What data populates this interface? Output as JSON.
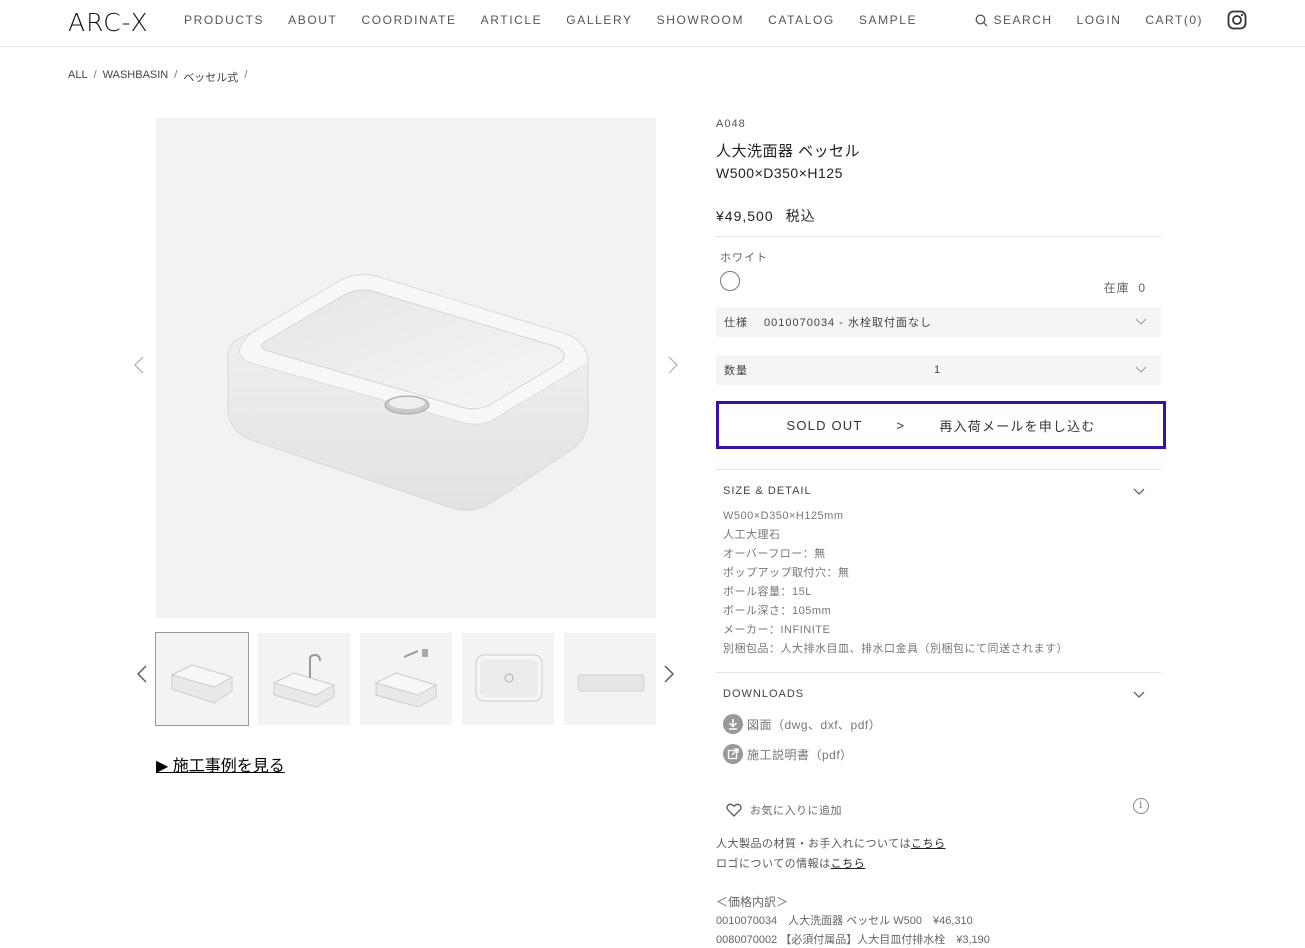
{
  "header": {
    "logo": "ARC-X",
    "nav": [
      "PRODUCTS",
      "ABOUT",
      "COORDINATE",
      "ARTICLE",
      "GALLERY",
      "SHOWROOM",
      "CATALOG",
      "SAMPLE"
    ],
    "search": "SEARCH",
    "login": "LOGIN",
    "cart": "CART(0)"
  },
  "breadcrumb": [
    "ALL",
    "WASHBASIN",
    "ベッセル式"
  ],
  "gallery": {
    "cases_link": "▶ 施工事例を見る"
  },
  "product": {
    "code": "A048",
    "name": "人大洗面器 ベッセル",
    "size": "W500×D350×H125",
    "price": "¥49,500",
    "tax": "税込",
    "color_label": "ホワイト",
    "stock_label": "在庫",
    "stock_value": "0",
    "spec_label": "仕様",
    "spec_value": "0010070034 - 水栓取付面なし",
    "qty_label": "数量",
    "qty_value": "1",
    "soldout": "SOLD OUT",
    "arrow": ">",
    "restock": "再入荷メールを申し込む"
  },
  "detail": {
    "title": "SIZE & DETAIL",
    "lines": [
      "W500×D350×H125mm",
      "人工大理石",
      "オーバーフロー：無",
      "ポップアップ取付穴：無",
      "ボール容量：15L",
      "ボール深さ：105mm",
      "メーカー：INFINITE",
      "別梱包品：人大排水目皿、排水口金具（別梱包にて同送されます）"
    ]
  },
  "downloads": {
    "title": "DOWNLOADS",
    "drawing": "図面（dwg、dxf、pdf）",
    "manual": "施工説明書（pdf）"
  },
  "favorite": "お気に入りに追加",
  "notes": {
    "material_text": "人大製品の材質・お手入れについては",
    "material_link": "こちら",
    "logo_text": "ロゴについての情報は",
    "logo_link": "こちら"
  },
  "price_breakdown": {
    "title": "＜価格内訳＞",
    "rows": [
      "0010070034　人大洗面器 ベッセル W500　¥46,310",
      "0080070002 【必須付属品】人大目皿付排水栓　¥3,190"
    ]
  }
}
